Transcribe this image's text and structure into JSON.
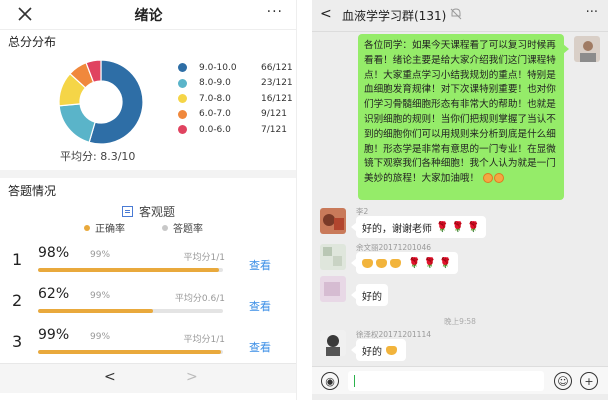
{
  "left": {
    "header": {
      "title": "绪论",
      "more": "···"
    },
    "score_section_title": "总分分布",
    "average_label": "平均分: 8.3/10",
    "chart_data": {
      "type": "pie",
      "title": "",
      "labels": [
        "9.0-10.0",
        "8.0-9.0",
        "7.0-8.0",
        "6.0-7.0",
        "0.0-6.0"
      ],
      "values": [
        66,
        23,
        16,
        9,
        7
      ],
      "counts": [
        "66/121",
        "23/121",
        "16/121",
        "9/121",
        "7/121"
      ],
      "colors": [
        "#2e6ea6",
        "#5ab4c9",
        "#f5d547",
        "#f0883c",
        "#e04360"
      ],
      "total": 121,
      "donut": true,
      "legend": "right"
    },
    "answers_section_title": "答题情况",
    "objective_label": "客观题",
    "correct_rate_label": "正确率",
    "answer_rate_label": "答题率",
    "correct_color": "#e9a93c",
    "answer_color": "#c8c8c8",
    "questions": [
      {
        "num": "1",
        "correct": "98%",
        "answer": "99%",
        "avg": "平均分1/1",
        "view": "查看",
        "correct_fraction": 0.98,
        "answer_fraction": 0.99
      },
      {
        "num": "2",
        "correct": "62%",
        "answer": "99%",
        "avg": "平均分0.6/1",
        "view": "查看",
        "correct_fraction": 0.62,
        "answer_fraction": 0.99
      },
      {
        "num": "3",
        "correct": "99%",
        "answer": "99%",
        "avg": "平均分1/1",
        "view": "查看",
        "correct_fraction": 0.99,
        "answer_fraction": 0.99
      }
    ],
    "footer": {
      "prev": "<",
      "next": ">"
    }
  },
  "right": {
    "header": {
      "back": "<",
      "title": "血液学学习群(131)",
      "more": "···"
    },
    "own_message": "各位同学：如果今天课程看了可以复习时候再看看！绪论主要是给大家介绍我们这门课程特点！大家重点学习小结我规划的重点！特别是血细胞发育规律！对下次课特别重要！也对你们学习骨髓细胞形态有非常大的帮助！也就是识别细胞的规则！当你们把规则掌握了当认不到的细胞你们可以用规则来分析到底是什么细胞！形态学是非常有意思的一门专业！在显微镜下观察我们各种细胞！我个人认为就是一门美妙的旅程！大家加油哦！",
    "messages": [
      {
        "sender": "李2",
        "text": "好的，谢谢老师",
        "roses": "🌹 🌹 🌹"
      },
      {
        "sender": "余文丽20171201046",
        "text": "",
        "roses": "🌹 🌹 🌹"
      },
      {
        "sender": "",
        "text": "好的"
      },
      {
        "sender": "徐泽权20171201114",
        "text": "好的"
      }
    ],
    "timestamp": "晚上9:58",
    "footer": {
      "voice": "◉",
      "emoji": "☺",
      "plus": "+"
    }
  }
}
